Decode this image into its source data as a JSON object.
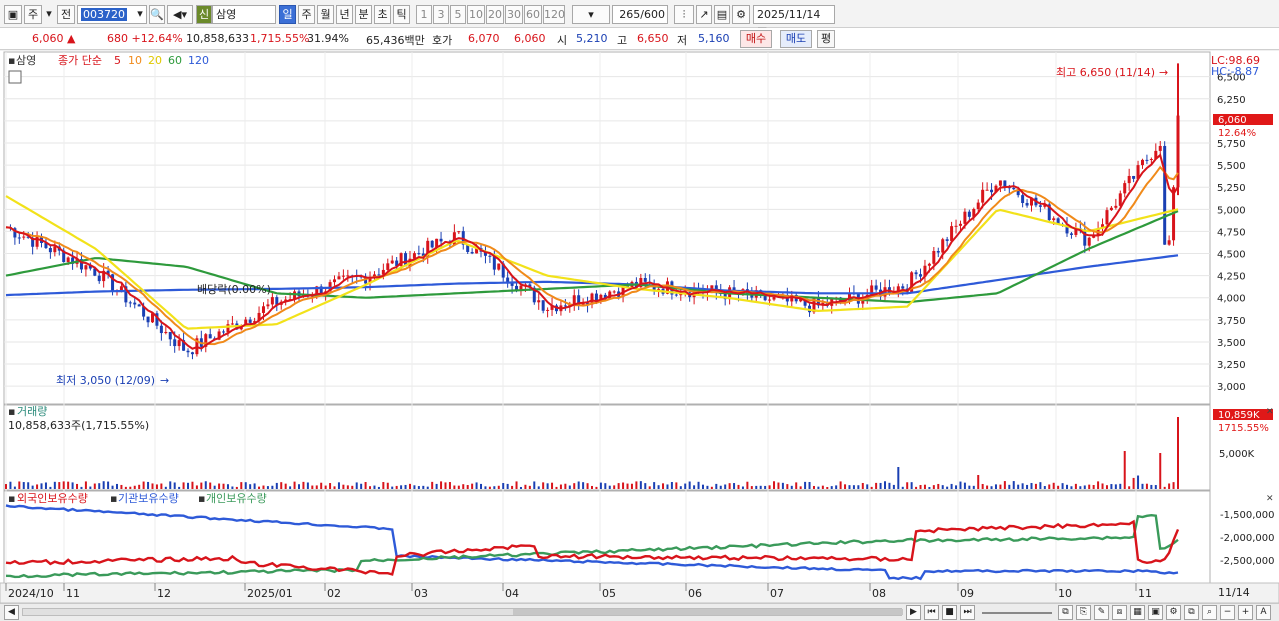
{
  "toolbar": {
    "market": "주",
    "prev": "전",
    "code": "003720",
    "new_badge": "신",
    "name": "삼영",
    "periods": [
      "일",
      "주",
      "월",
      "년",
      "분",
      "초",
      "틱"
    ],
    "active_period": "일",
    "intervals": [
      "1",
      "3",
      "5",
      "10",
      "20",
      "30",
      "60",
      "120"
    ],
    "count": "265",
    "count_total": "/600",
    "date": "2025/11/14"
  },
  "info": {
    "price": "6,060",
    "change": "680",
    "change_pct": "+12.64%",
    "volume": "10,858,633",
    "vol_pct": "1,715.55%",
    "turnover": "31.94%",
    "amount": "65,436백만",
    "quote_label": "호가",
    "ask": "6,070",
    "bid": "6,060",
    "open_label": "시",
    "open": "5,210",
    "high_label": "고",
    "high": "6,650",
    "low_label": "저",
    "low": "5,160",
    "buy_btn": "매수",
    "sell_btn": "매도",
    "avg_btn": "평"
  },
  "price_panel": {
    "stock_label": "삼영",
    "ma_title": "종가 단순",
    "ma_periods": [
      "5",
      "10",
      "20",
      "60",
      "120"
    ],
    "lc": "LC:98.69",
    "hc": "HC:-8.87",
    "price_tag": "6,060",
    "pct_tag": "12.64%",
    "max_label": "최고 6,650 (11/14)",
    "min_label": "최저 3,050 (12/09)",
    "dividend_label": "배당락(0.00%)"
  },
  "volume_panel": {
    "title": "거래량",
    "value_text": "10,858,633주(1,715.55%)",
    "tag": "10,859K",
    "tag_pct": "1715.55%",
    "axis_label": "5,000K"
  },
  "holding_panel": {
    "titles": [
      "외국인보유수량",
      "기관보유수량",
      "개인보유수량"
    ],
    "axis_labels": [
      "-1,500,000",
      "-2,000,000",
      "-2,500,000"
    ]
  },
  "time_axis": {
    "labels": [
      "2024/10",
      "11",
      "12",
      "2025/01",
      "02",
      "03",
      "04",
      "05",
      "06",
      "07",
      "08",
      "09",
      "10",
      "11"
    ],
    "end_label": "11/14"
  },
  "colors": {
    "up": "#d8141b",
    "down": "#1a3fb3",
    "ma5": "#d8141b",
    "ma10": "#f08a1a",
    "ma20": "#f2e21a",
    "ma60": "#2e9a3c",
    "ma120": "#2e5ad8",
    "foreign": "#d8141b",
    "inst": "#2e5ad8",
    "retail": "#3a9a5a"
  },
  "chart_data": {
    "type": "candlestick",
    "y_axis": {
      "ticks": [
        "6,500",
        "6,250",
        "6,000",
        "5,750",
        "5,500",
        "5,250",
        "5,000",
        "4,750",
        "4,500",
        "4,250",
        "4,000",
        "3,750",
        "3,500",
        "3,250",
        "3,000"
      ]
    },
    "x": [
      "2024/10",
      "11",
      "12",
      "2025/01",
      "02",
      "03",
      "04",
      "05",
      "06",
      "07",
      "08",
      "09",
      "10",
      "11"
    ],
    "close": [
      4800,
      4300,
      3400,
      3950,
      4250,
      4700,
      3900,
      4150,
      4050,
      3900,
      4150,
      5350,
      4650,
      6060
    ],
    "high": [
      5100,
      4600,
      4000,
      4100,
      4400,
      4900,
      4350,
      4350,
      4200,
      4150,
      4700,
      6050,
      5050,
      6650
    ],
    "low": [
      4500,
      3750,
      3050,
      3550,
      3850,
      4300,
      3500,
      3900,
      3850,
      3650,
      3950,
      4700,
      4400,
      4400
    ],
    "ma120": [
      4030,
      4070,
      4090,
      4100,
      4120,
      4160,
      4180,
      4150,
      4080,
      4050,
      4050,
      4200,
      4350,
      4480
    ],
    "ma60": [
      4250,
      4450,
      4350,
      4050,
      4000,
      4050,
      4100,
      4150,
      4050,
      4000,
      3950,
      4050,
      4550,
      4980
    ],
    "ma20": [
      5150,
      4550,
      3650,
      3700,
      4150,
      4650,
      4250,
      4100,
      4000,
      3850,
      3900,
      5000,
      4750,
      5000
    ]
  }
}
